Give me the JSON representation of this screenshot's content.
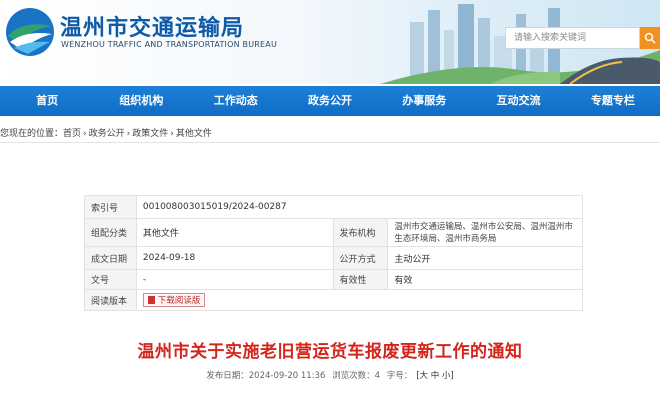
{
  "header": {
    "title": "温州市交通运输局",
    "subtitle": "WENZHOU TRAFFIC AND TRANSPORTATION BUREAU",
    "search_placeholder": "请输入搜索关键词"
  },
  "nav": {
    "items": [
      "首页",
      "组织机构",
      "工作动态",
      "政务公开",
      "办事服务",
      "互动交流",
      "专题专栏"
    ]
  },
  "breadcrumb": {
    "prefix": "您现在的位置：",
    "items": [
      "首页",
      "政务公开",
      "政策文件",
      "其他文件"
    ],
    "separator": "›"
  },
  "info": {
    "index_label": "索引号",
    "index_value": "001008003015019/2024-00287",
    "category_label": "组配分类",
    "category_value": "其他文件",
    "publisher_label": "发布机构",
    "publisher_value": "温州市交通运输局、温州市公安局、温州温州市生态环境局、温州市商务局",
    "date_label": "成文日期",
    "date_value": "2024-09-18",
    "disclosure_label": "公开方式",
    "disclosure_value": "主动公开",
    "doc_no_label": "文号",
    "doc_no_value": "-",
    "validity_label": "有效性",
    "validity_value": "有效",
    "reader_label": "阅读版本",
    "reader_button": "下载阅读版"
  },
  "article": {
    "title": "温州市关于实施老旧营运货车报废更新工作的通知",
    "publish_time": "发布日期：2024-09-20 11:36",
    "views": "浏览次数：4",
    "font_size_label": "字号：",
    "font_size_options": "[大 中 小]"
  },
  "colors": {
    "nav_blue": "#0f6cc4",
    "title_blue": "#0d5aa7",
    "article_red": "#d4251c",
    "search_orange": "#f29122"
  }
}
